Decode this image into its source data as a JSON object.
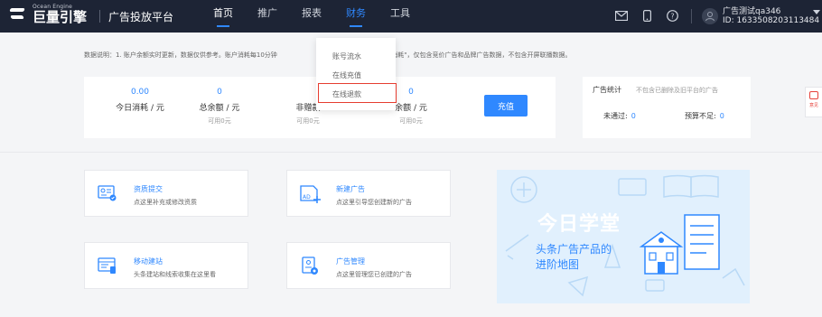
{
  "header": {
    "logo_small": "Ocean Engine",
    "logo_big": "巨量引擎",
    "platform": "广告投放平台",
    "nav": [
      {
        "label": "首页"
      },
      {
        "label": "推广"
      },
      {
        "label": "报表"
      },
      {
        "label": "财务"
      },
      {
        "label": "工具"
      }
    ],
    "icons": [
      "mail-icon",
      "phone-icon",
      "help-icon"
    ],
    "user": {
      "name": "广告测试qa346",
      "id": "ID: 1633508203113484"
    }
  },
  "notice": "数据说明：1. 账户余额实时更新，数据仅供参考。账户消耗每10分钟",
  "notice_tail": "消耗\"和\"账户消耗\"，仅包含竞价广告和品牌广告数据，不包含开屏联播数据。",
  "stats": [
    {
      "value": "0.00",
      "label": "今日消耗 / 元",
      "sub": ""
    },
    {
      "value": "0",
      "label": "总余额 / 元",
      "sub": "可用0元"
    },
    {
      "value": "",
      "label": "非赠款",
      "sub": "可用0元"
    },
    {
      "value": "0",
      "label": "余额 / 元",
      "sub": "可用0元"
    }
  ],
  "recharge_label": "充值",
  "ad_stats": {
    "title": "广告统计",
    "note": "不包含已删除及旧平台的广告",
    "not_passed_label": "未通过:",
    "not_passed_value": "0",
    "budget_label": "预算不足:",
    "budget_value": "0"
  },
  "float_tab": "意见",
  "dropdown": {
    "items": [
      "账号流水",
      "在线充值",
      "在线退款"
    ],
    "highlighted": "在线退款"
  },
  "features": [
    {
      "title": "资质提交",
      "desc": "点这里补充或修改资质",
      "icon": "certificate-icon"
    },
    {
      "title": "新建广告",
      "desc": "点这里引导您创建新的广告",
      "icon": "ad-plus-icon"
    },
    {
      "title": "移动建站",
      "desc": "头条建站和线索收集在这里看",
      "icon": "mobile-site-icon"
    },
    {
      "title": "广告管理",
      "desc": "点这里管理您已创建的广告",
      "icon": "ad-manage-icon"
    }
  ],
  "banner": {
    "title": "今日学堂",
    "sub1": "头条广告产品的",
    "sub2": "进阶地图"
  },
  "colors": {
    "accent": "#2f88ff",
    "topbar": "#1d2435",
    "highlight": "#e63d30"
  }
}
